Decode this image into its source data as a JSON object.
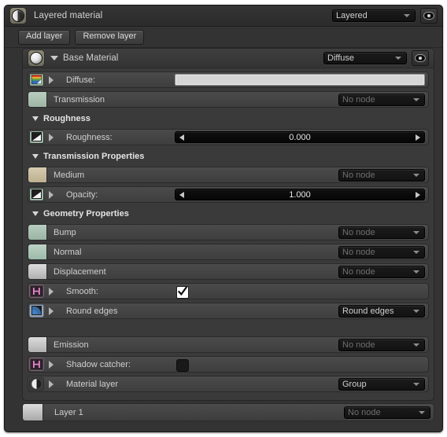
{
  "window": {
    "title": "Layered material",
    "title_icon": "material-ball-icon",
    "type_dropdown": "Layered",
    "visibility_icon": "eye-icon"
  },
  "toolbar": {
    "add_layer": "Add layer",
    "remove_layer": "Remove layer"
  },
  "node": {
    "title": "Base Material",
    "icon": "material-ball-icon",
    "expand_icon": "triangle-down-icon",
    "type_dropdown": "Diffuse",
    "visibility_icon": "eye-icon"
  },
  "no_node": "No node",
  "groups": {
    "roughness": "Roughness",
    "transmission_properties": "Transmission Properties",
    "geometry_properties": "Geometry Properties"
  },
  "rows": {
    "diffuse": {
      "label": "Diffuse:",
      "icon": "image-texture-icon",
      "value": "",
      "swatch": "#d6d6d6"
    },
    "transmission": {
      "label": "Transmission",
      "icon": "color-swatch-icon",
      "value": "No node",
      "swatch": "#a9bfb1"
    },
    "roughness": {
      "label": "Roughness:",
      "icon": "float-texture-icon",
      "value": "0.000"
    },
    "medium": {
      "label": "Medium",
      "icon": "color-swatch-icon",
      "value": "No node",
      "swatch": "#c6bb9e"
    },
    "opacity": {
      "label": "Opacity:",
      "icon": "float-texture-icon",
      "value": "1.000"
    },
    "bump": {
      "label": "Bump",
      "icon": "color-swatch-icon",
      "value": "No node",
      "swatch": "#a7bfb2"
    },
    "normal": {
      "label": "Normal",
      "icon": "color-swatch-icon",
      "value": "No node",
      "swatch": "#a9c3b5"
    },
    "displacement": {
      "label": "Displacement",
      "icon": "color-swatch-icon",
      "value": "No node",
      "swatch": "#c3c3c3"
    },
    "smooth": {
      "label": "Smooth:",
      "icon": "bool-node-icon",
      "checked": true
    },
    "round_edges": {
      "label": "Round edges",
      "icon": "round-edges-icon",
      "value": "Round edges"
    },
    "emission": {
      "label": "Emission",
      "icon": "color-swatch-icon",
      "value": "No node",
      "swatch": "#c3c3c3"
    },
    "shadow_catcher": {
      "label": "Shadow catcher:",
      "icon": "bool-node-icon",
      "checked": false
    },
    "material_layer": {
      "label": "Material layer",
      "icon": "material-ball-icon",
      "value": "Group"
    }
  },
  "layer": {
    "label": "Layer 1",
    "value": "No node",
    "swatch": "#c3c3c3"
  },
  "colors": {
    "panel_bg": "#333333",
    "frame_bg": "#3a3a3a",
    "row_top": "#4b4b4b",
    "row_bottom": "#3e3e3e",
    "text": "#cfcfcf",
    "dim_text": "#6f6f6f",
    "slider_bg": "#0d0d0d"
  }
}
